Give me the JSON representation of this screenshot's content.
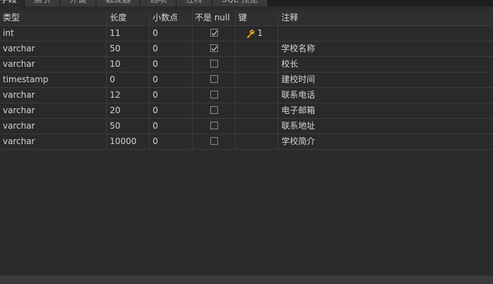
{
  "tabs": [
    {
      "label": "字段",
      "active": true
    },
    {
      "label": "索引",
      "active": false
    },
    {
      "label": "外键",
      "active": false
    },
    {
      "label": "触发器",
      "active": false
    },
    {
      "label": "选项",
      "active": false
    },
    {
      "label": "注释",
      "active": false
    },
    {
      "label": "SQL 预览",
      "active": false
    }
  ],
  "columns": {
    "type": "类型",
    "length": "长度",
    "decimals": "小数点",
    "not_null": "不是 null",
    "key": "键",
    "comment": "注释"
  },
  "rows": [
    {
      "type": "int",
      "length": "11",
      "decimals": "0",
      "not_null": true,
      "key": "1",
      "comment": ""
    },
    {
      "type": "varchar",
      "length": "50",
      "decimals": "0",
      "not_null": true,
      "key": "",
      "comment": "学校名称"
    },
    {
      "type": "varchar",
      "length": "10",
      "decimals": "0",
      "not_null": false,
      "key": "",
      "comment": "校长"
    },
    {
      "type": "timestamp",
      "length": "0",
      "decimals": "0",
      "not_null": false,
      "key": "",
      "comment": "建校时间"
    },
    {
      "type": "varchar",
      "length": "12",
      "decimals": "0",
      "not_null": false,
      "key": "",
      "comment": "联系电话"
    },
    {
      "type": "varchar",
      "length": "20",
      "decimals": "0",
      "not_null": false,
      "key": "",
      "comment": "电子邮箱"
    },
    {
      "type": "varchar",
      "length": "50",
      "decimals": "0",
      "not_null": false,
      "key": "",
      "comment": "联系地址"
    },
    {
      "type": "varchar",
      "length": "10000",
      "decimals": "0",
      "not_null": false,
      "key": "",
      "comment": "学校简介"
    }
  ],
  "icons": {
    "primary_key": "key-icon"
  },
  "colors": {
    "key_gold": "#e8a317"
  }
}
